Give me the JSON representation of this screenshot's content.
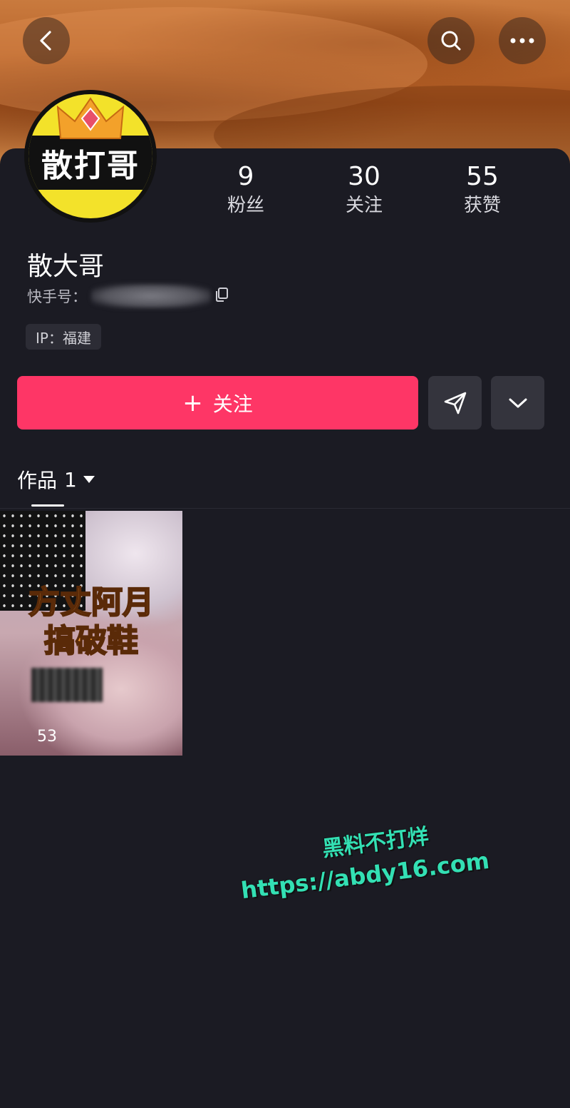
{
  "profile": {
    "avatar_text": "散打哥",
    "nickname": "散大哥",
    "account_label": "快手号：",
    "ip_tag": "IP：福建"
  },
  "stats": [
    {
      "value": "9",
      "label": "粉丝"
    },
    {
      "value": "30",
      "label": "关注"
    },
    {
      "value": "55",
      "label": "获赞"
    }
  ],
  "actions": {
    "follow_plus": "+",
    "follow_label": "关注"
  },
  "works": {
    "tab_label": "作品",
    "tab_count": "1",
    "items": [
      {
        "title_line1": "方丈阿月",
        "title_line2": "搞破鞋",
        "count": "53"
      }
    ]
  },
  "watermark": {
    "line1": "黑料不打烊",
    "line2": "https://abdy16.com"
  },
  "colors": {
    "accent": "#fe3666",
    "background": "#1b1b23",
    "watermark": "#33e0b4"
  },
  "icons": [
    "back-icon",
    "search-icon",
    "more-icon",
    "copy-icon",
    "send-icon",
    "chevron-down-icon",
    "caret-down-icon",
    "crown-icon"
  ]
}
